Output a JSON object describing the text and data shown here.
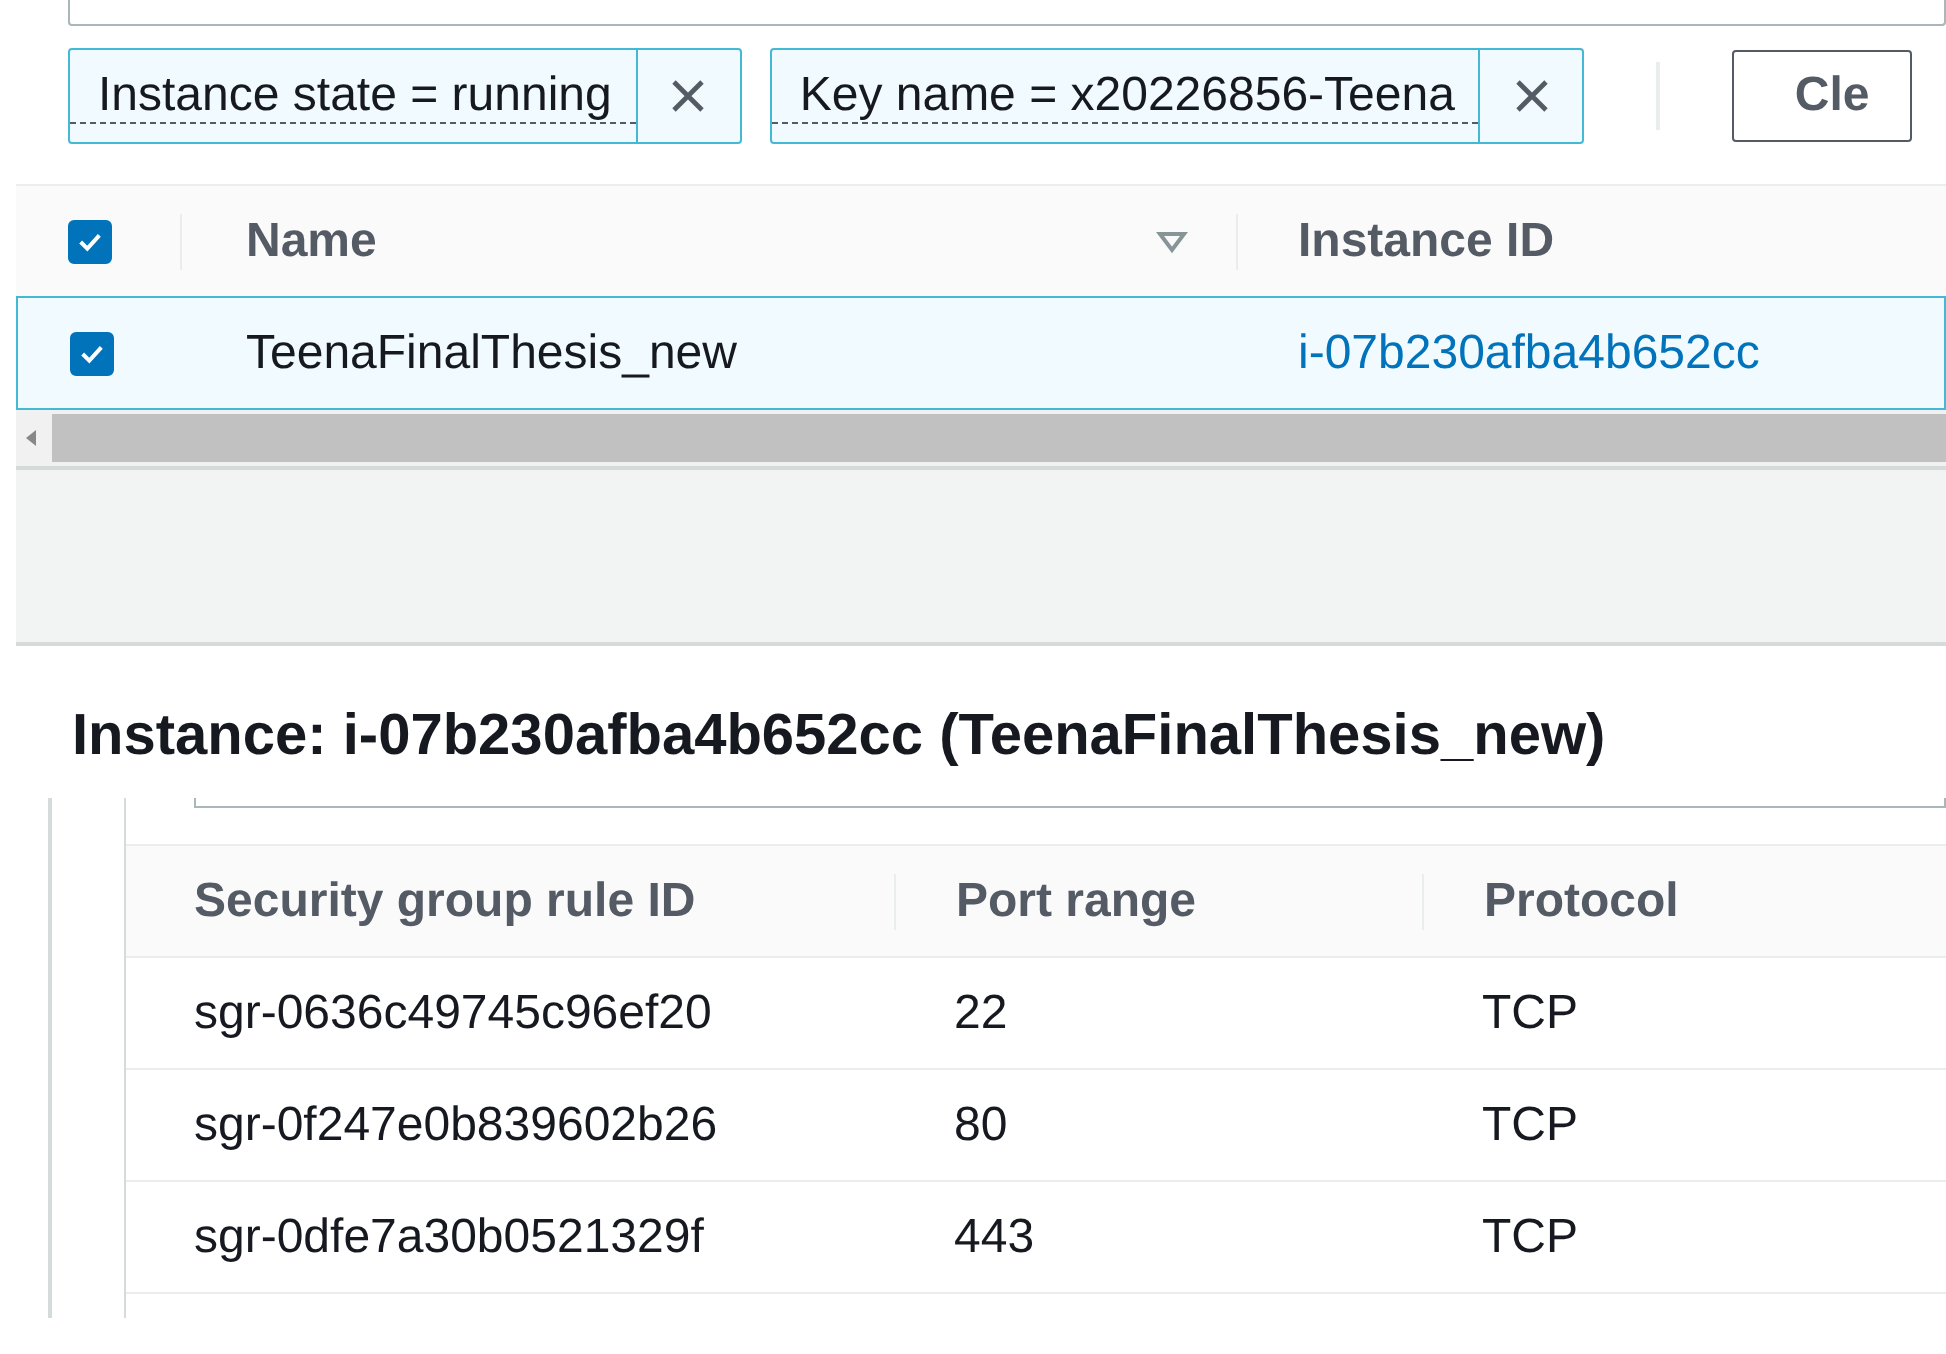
{
  "filters": [
    {
      "label": "Instance state = running"
    },
    {
      "label": "Key name = x20226856-Teena"
    }
  ],
  "clear_button": "Cle",
  "instances": {
    "select_all_checked": true,
    "columns": [
      {
        "label": "Name",
        "sortable": true
      },
      {
        "label": "Instance ID",
        "sortable": false
      }
    ],
    "rows": [
      {
        "selected": true,
        "name": "TeenaFinalThesis_new",
        "instance_id": "i-07b230afba4b652cc"
      }
    ]
  },
  "details_title": "Instance: i-07b230afba4b652cc (TeenaFinalThesis_new)",
  "rules": {
    "columns": [
      "Security group rule ID",
      "Port range",
      "Protocol"
    ],
    "rows": [
      [
        "sgr-0636c49745c96ef20",
        "22",
        "TCP"
      ],
      [
        "sgr-0f247e0b839602b26",
        "80",
        "TCP"
      ],
      [
        "sgr-0dfe7a30b0521329f",
        "443",
        "TCP"
      ]
    ]
  }
}
